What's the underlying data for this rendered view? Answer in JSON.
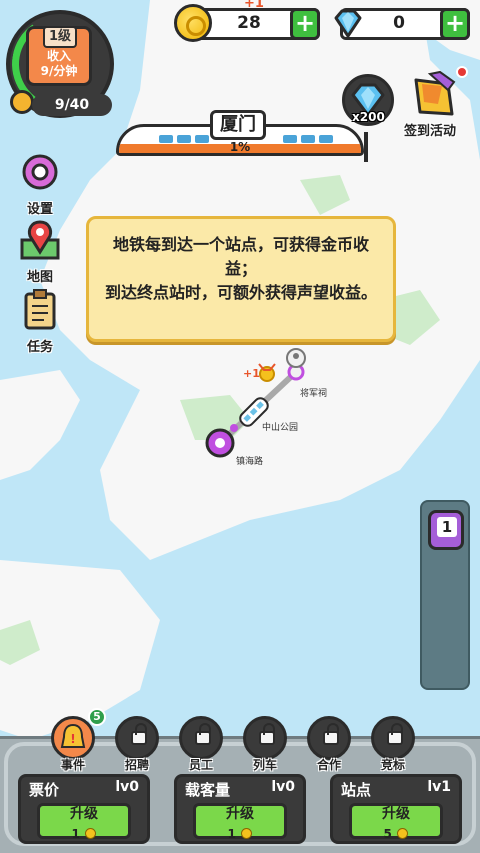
{
  "currency": {
    "coins": "28",
    "coin_delta": "+1",
    "gems": "0"
  },
  "level": {
    "title": "1级",
    "income_label": "收入",
    "income_rate": "9/分钟",
    "progress": "9/40"
  },
  "city": {
    "name": "厦门",
    "progress": "1%"
  },
  "gem_reward": "x200",
  "checkin_label": "签到活动",
  "side_menu": [
    {
      "label": "设置",
      "icon": "gear-icon"
    },
    {
      "label": "地图",
      "icon": "map-pin-icon"
    },
    {
      "label": "任务",
      "icon": "clipboard-icon"
    }
  ],
  "tooltip": {
    "line1": "地铁每到达一个站点，可获得金币收益；",
    "line2": "到达终点站时，可额外获得声望收益。"
  },
  "map": {
    "coin_reward": "+1",
    "stations": [
      "将军祠",
      "中山公园",
      "镇海路"
    ]
  },
  "line_number": "1",
  "features": [
    {
      "label": "事件",
      "locked": false,
      "badge": "5"
    },
    {
      "label": "招聘",
      "locked": true
    },
    {
      "label": "员工",
      "locked": true
    },
    {
      "label": "列车",
      "locked": true
    },
    {
      "label": "合作",
      "locked": true
    },
    {
      "label": "竞标",
      "locked": true
    }
  ],
  "upgrades": [
    {
      "name": "票价",
      "level": "lv0",
      "button": "升级",
      "cost": "1"
    },
    {
      "name": "载客量",
      "level": "lv0",
      "button": "升级",
      "cost": "1"
    },
    {
      "name": "站点",
      "level": "lv1",
      "button": "升级",
      "cost": "5"
    }
  ],
  "colors": {
    "water": "#bfe6f7",
    "land": "#f7f7f7",
    "park": "#cfeccb",
    "route": "#a9a9a9",
    "station": "#c04fe0",
    "accent_green": "#7bd84a",
    "tooltip_bg": "#fbe9a8"
  }
}
